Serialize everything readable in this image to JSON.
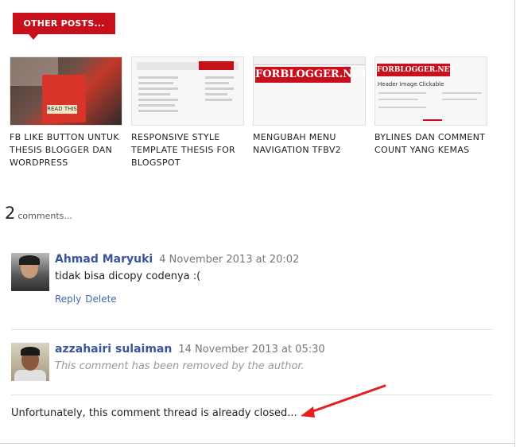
{
  "section": {
    "title": "OTHER POSTS..."
  },
  "posts": [
    {
      "title": "FB LIKE BUTTON UNTUK THESIS BLOGGER DAN WORDPRESS",
      "thumb_text": "READ THIS"
    },
    {
      "title": "RESPONSIVE STYLE TEMPLATE THESIS FOR BLOGSPOT",
      "thumb_text": ""
    },
    {
      "title": "MENGUBAH MENU NAVIGATION TFBV2",
      "thumb_text": "FORBLOGGER.NET"
    },
    {
      "title": "BYLINES DAN COMMENT COUNT YANG KEMAS",
      "thumb_text": "FORBLOGGER.NET",
      "thumb_heading": "Header Image Clickable"
    }
  ],
  "comments_header": {
    "count": "2",
    "label": "comments..."
  },
  "comments": [
    {
      "author": "Ahmad Maryuki",
      "time": "4 November 2013 at 20:02",
      "body": "tidak bisa dicopy codenya :(",
      "reply": "Reply",
      "delete": "Delete"
    },
    {
      "author": "azzahairi sulaiman",
      "time": "14 November 2013 at 05:30",
      "body": "This comment has been removed by the author."
    }
  ],
  "closed_note": "Unfortunately, this comment thread is already closed...",
  "colors": {
    "accent": "#c8101d",
    "link": "#3a55a0"
  },
  "icons": [
    "avatar-ahmad",
    "avatar-azzahairi",
    "red-arrow"
  ]
}
